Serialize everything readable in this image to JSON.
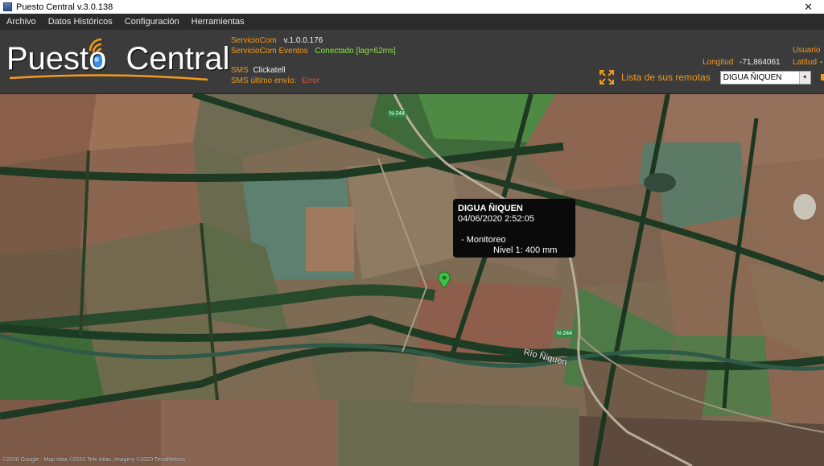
{
  "window": {
    "title": "Puesto Central v.3.0.138",
    "close_glyph": "✕"
  },
  "menu": [
    "Archivo",
    "Datos Históricos",
    "Configuración",
    "Herramientas"
  ],
  "logo": {
    "word1": "Puesto",
    "word2": "Central"
  },
  "services": {
    "serviciocom_label": "ServicioCom",
    "serviciocom_version": "v.1.0.0.176",
    "eventos_label": "ServicioCom Eventos",
    "eventos_status": "Conectado [lag=62ms]",
    "sms_label": "SMS",
    "sms_value": "Clickatell",
    "sms_last_label": "SMS último envío:",
    "sms_last_value": "Error"
  },
  "right_panel": {
    "usuario_label": "Usuario",
    "longitud_label": "Longitud",
    "longitud_value": "-71,864061",
    "latitud_label": "Latitud",
    "latitud_value": "-",
    "remotes_label": "Lista de sus remotas",
    "selected_remote": "DIGUA ÑIQUEN"
  },
  "popup": {
    "name": "DIGUA ÑIQUEN",
    "datetime": "04/06/2020 2:52:05",
    "mode": "- Monitoreo",
    "level": "Nivel 1: 400 mm"
  },
  "map": {
    "road_label_1": "N-244",
    "road_label_2": "N-244",
    "river_label": "Río Ñiquen",
    "attribution": "©2020 Google - Map data ©2020 Tele Atlas, Imagery ©2020 TerraMetrics",
    "marker_color": "#3fc24a"
  },
  "colors": {
    "accent": "#f39a1b",
    "header_bg": "#3b3b3b",
    "menu_bg": "#2b2b2b"
  }
}
